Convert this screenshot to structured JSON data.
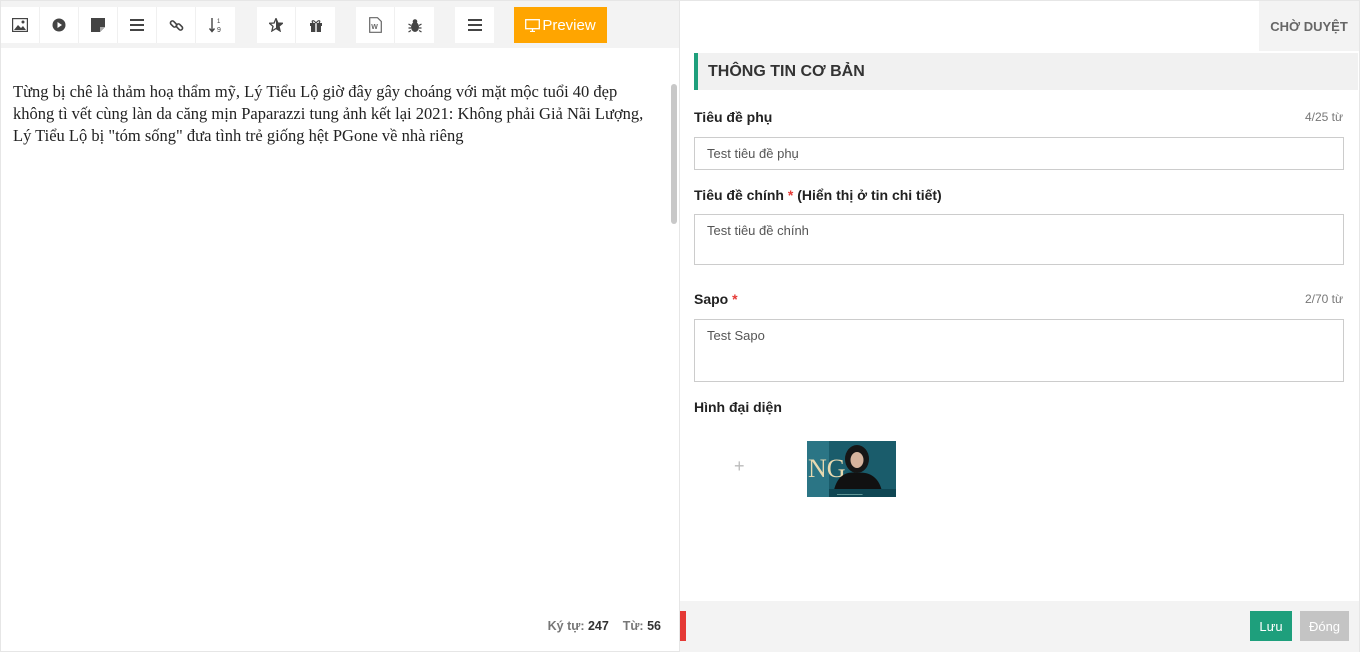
{
  "toolbar": {
    "group1": [
      {
        "icon": "image-icon"
      },
      {
        "icon": "video-play-icon"
      },
      {
        "icon": "note-icon"
      },
      {
        "icon": "list-icon"
      },
      {
        "icon": "link-icon"
      },
      {
        "icon": "sort-numeric-icon"
      }
    ],
    "group2": [
      {
        "icon": "star-icon"
      },
      {
        "icon": "gift-icon"
      }
    ],
    "group3": [
      {
        "icon": "word-document-icon"
      },
      {
        "icon": "bug-icon"
      }
    ],
    "menu_icon": "menu-icon",
    "preview_label": "Preview",
    "preview_color": "#ffa500"
  },
  "editor": {
    "content": "Từng bị chê là thảm hoạ thẩm mỹ, Lý Tiểu Lộ giờ đây gây choáng với mặt mộc tuổi 40 đẹp không tì vết cùng làn da căng mịn Paparazzi tung ảnh kết lại 2021: Không phải Giả Nãi Lượng, Lý Tiểu Lộ bị \"tóm sống\" đưa tình trẻ giống hệt PGone về nhà riêng",
    "char_label": "Ký tự:",
    "char_count": "247",
    "word_label": "Từ:",
    "word_count": "56"
  },
  "form": {
    "status_tab": "CHỜ DUYỆT",
    "section_title": "THÔNG TIN CƠ BẢN",
    "accent_color": "#1e9f7c",
    "subtitle": {
      "label": "Tiêu đề phụ",
      "counter": "4/25 từ",
      "value": "Test tiêu đề phụ"
    },
    "main_title": {
      "label": "Tiêu đề chính",
      "required": "*",
      "note": "(Hiển thị ở tin chi tiết)",
      "value": "Test tiêu đề chính"
    },
    "sapo": {
      "label": "Sapo",
      "required": "*",
      "counter": "2/70 từ",
      "value": "Test Sapo"
    },
    "avatar": {
      "label": "Hình đại diện",
      "add_symbol": "+"
    },
    "footer": {
      "save_label": "Lưu",
      "close_label": "Đóng"
    }
  }
}
